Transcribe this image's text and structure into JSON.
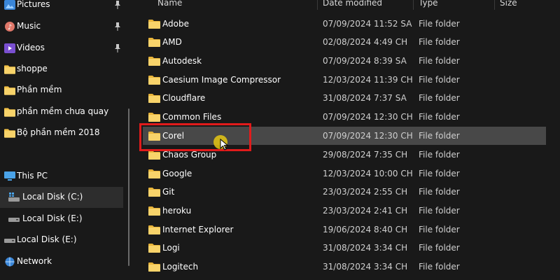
{
  "sidebar": {
    "items": [
      {
        "label": "Pictures",
        "icon": "pictures-icon",
        "pinned": true
      },
      {
        "label": "Music",
        "icon": "music-icon",
        "pinned": true
      },
      {
        "label": "Videos",
        "icon": "videos-icon",
        "pinned": true
      },
      {
        "label": "shoppe",
        "icon": "folder-icon",
        "pinned": false
      },
      {
        "label": "Phần mềm",
        "icon": "folder-icon",
        "pinned": false
      },
      {
        "label": "phần mềm chưa quay",
        "icon": "folder-icon",
        "pinned": false
      },
      {
        "label": "Bộ phần mềm 2018",
        "icon": "folder-icon",
        "pinned": false
      },
      {
        "label": "This PC",
        "icon": "pc-icon",
        "pinned": false
      },
      {
        "label": "Local Disk (C:)",
        "icon": "windows-drive-icon",
        "pinned": false,
        "selected": true
      },
      {
        "label": "Local Disk (E:)",
        "icon": "drive-icon",
        "pinned": false
      },
      {
        "label": "Local Disk (E:)",
        "icon": "drive-icon",
        "pinned": false
      },
      {
        "label": "Network",
        "icon": "network-icon",
        "pinned": false
      }
    ]
  },
  "columns": {
    "name": "Name",
    "date": "Date modified",
    "type": "Type",
    "size": "Size"
  },
  "files": [
    {
      "name": "Adobe",
      "date": "07/09/2024 11:52 SA",
      "type": "File folder"
    },
    {
      "name": "AMD",
      "date": "02/08/2024 4:49 CH",
      "type": "File folder"
    },
    {
      "name": "Autodesk",
      "date": "07/09/2024 8:39 SA",
      "type": "File folder"
    },
    {
      "name": "Caesium Image Compressor",
      "date": "12/03/2024 11:39 CH",
      "type": "File folder"
    },
    {
      "name": "Cloudflare",
      "date": "31/08/2024 7:37 SA",
      "type": "File folder"
    },
    {
      "name": "Common Files",
      "date": "07/09/2024 12:30 CH",
      "type": "File folder"
    },
    {
      "name": "Corel",
      "date": "07/09/2024 12:30 CH",
      "type": "File folder",
      "selected": true
    },
    {
      "name": "Chaos Group",
      "date": "29/08/2024 7:35 CH",
      "type": "File folder"
    },
    {
      "name": "Google",
      "date": "12/03/2024 10:00 CH",
      "type": "File folder"
    },
    {
      "name": "Git",
      "date": "23/03/2024 2:55 CH",
      "type": "File folder"
    },
    {
      "name": "heroku",
      "date": "23/03/2024 2:41 CH",
      "type": "File folder"
    },
    {
      "name": "Internet Explorer",
      "date": "19/06/2024 8:40 CH",
      "type": "File folder"
    },
    {
      "name": "Logi",
      "date": "31/08/2024 3:34 CH",
      "type": "File folder"
    },
    {
      "name": "Logitech",
      "date": "31/08/2024 3:34 CH",
      "type": "File folder"
    }
  ],
  "colors": {
    "accent_folder": "#f3c248",
    "highlight_box": "#e11b1b",
    "selection": "#484848"
  }
}
